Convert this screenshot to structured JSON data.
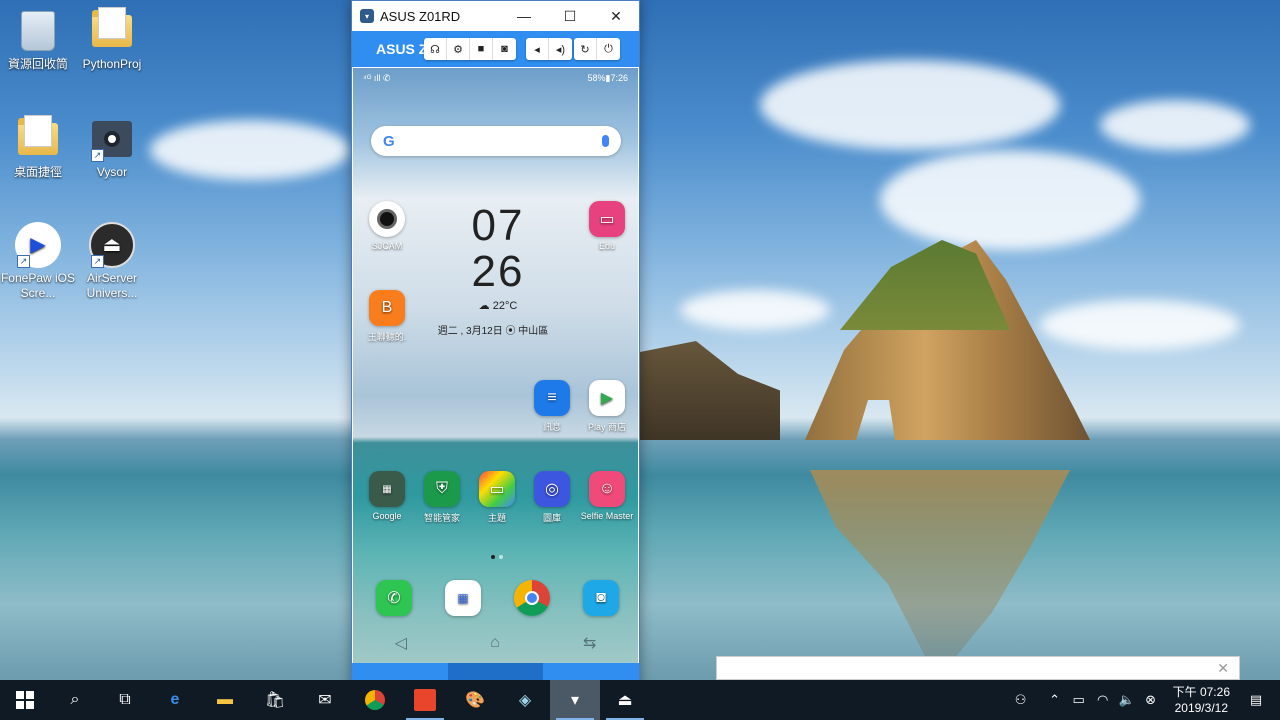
{
  "desktop": {
    "icons": [
      {
        "label": "資源回收筒",
        "icon": "recycle-bin-icon"
      },
      {
        "label": "PythonProj",
        "icon": "folder-icon"
      },
      {
        "label": "桌面捷徑",
        "icon": "folder-shortcut-icon"
      },
      {
        "label": "Vysor",
        "icon": "vysor-app-icon"
      },
      {
        "label": "FonePaw iOS Scre...",
        "icon": "fonepaw-icon"
      },
      {
        "label": "AirServer Univers...",
        "icon": "airserver-icon"
      }
    ]
  },
  "vysor": {
    "window_title": "ASUS Z01RD",
    "device_name": "ASUS Z",
    "accent": "#2f8ef0"
  },
  "phone": {
    "status_right": "58%▮7:26",
    "clock_hour": "07",
    "clock_minute": "26",
    "weather": "22°C",
    "date_location": "週二 , 3月12日  ⦿ 中山區",
    "apps": {
      "sjcam": "SJCAM",
      "edu": "Edu",
      "wangji": "王聯聽的.",
      "messages": "訊息",
      "play": "Play 商店",
      "google": "Google",
      "manager": "智能管家",
      "themes": "主題",
      "gallery": "圖庫",
      "selfie": "Selfie Master"
    }
  },
  "taskbar": {
    "clock_ampm_time": "下午 07:26",
    "clock_date": "2019/3/12"
  }
}
